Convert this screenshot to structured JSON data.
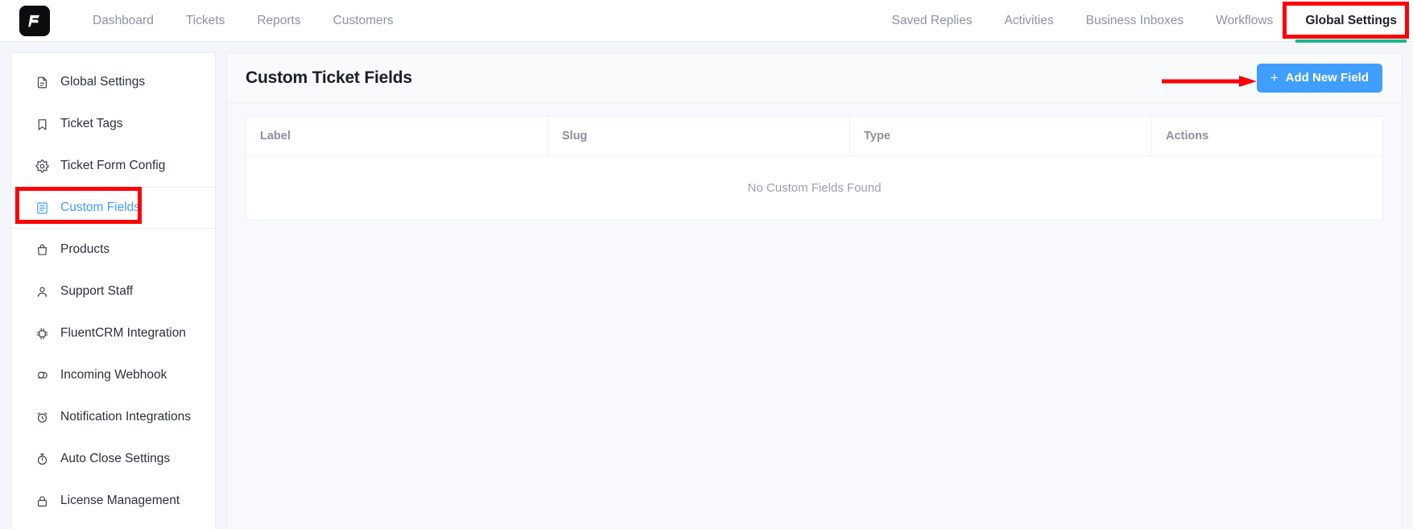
{
  "app": {
    "logo_icon": "fluent-support-logo-icon",
    "brand_color": "#0b0d0f"
  },
  "topnav": {
    "left_items": [
      {
        "label": "Dashboard",
        "name": "nav-dashboard"
      },
      {
        "label": "Tickets",
        "name": "nav-tickets"
      },
      {
        "label": "Reports",
        "name": "nav-reports"
      },
      {
        "label": "Customers",
        "name": "nav-customers"
      }
    ],
    "right_items": [
      {
        "label": "Saved Replies",
        "name": "nav-saved-replies",
        "active": false
      },
      {
        "label": "Activities",
        "name": "nav-activities",
        "active": false
      },
      {
        "label": "Business Inboxes",
        "name": "nav-business-inboxes",
        "active": false
      },
      {
        "label": "Workflows",
        "name": "nav-workflows",
        "active": false
      },
      {
        "label": "Global Settings",
        "name": "nav-global-settings",
        "active": true
      }
    ],
    "active_underline_color": "#10bc8c"
  },
  "sidebar": {
    "items": [
      {
        "label": "Global Settings",
        "icon": "document-icon",
        "active": false
      },
      {
        "label": "Ticket Tags",
        "icon": "bookmark-icon",
        "active": false
      },
      {
        "label": "Ticket Form Config",
        "icon": "gear-icon",
        "active": false
      },
      {
        "label": "Custom Fields",
        "icon": "list-document-icon",
        "active": true
      },
      {
        "label": "Products",
        "icon": "bag-icon",
        "active": false
      },
      {
        "label": "Support Staff",
        "icon": "user-icon",
        "active": false
      },
      {
        "label": "FluentCRM Integration",
        "icon": "chip-icon",
        "active": false
      },
      {
        "label": "Incoming Webhook",
        "icon": "webhook-icon",
        "active": false
      },
      {
        "label": "Notification Integrations",
        "icon": "alarm-icon",
        "active": false
      },
      {
        "label": "Auto Close Settings",
        "icon": "timer-icon",
        "active": false
      },
      {
        "label": "License Management",
        "icon": "lock-icon",
        "active": false
      }
    ],
    "active_color": "#409eff"
  },
  "main": {
    "title": "Custom Ticket Fields",
    "add_button": {
      "label": "Add New Field",
      "plus": "+",
      "color": "#409eff"
    },
    "table": {
      "headers": [
        "Label",
        "Slug",
        "Type",
        "Actions"
      ],
      "rows": [],
      "empty_message": "No Custom Fields Found"
    }
  },
  "annotations": {
    "color": "#fb0007",
    "boxes": [
      {
        "target": "Global Settings",
        "name": "annotation-box-global-settings"
      },
      {
        "target": "Custom Fields",
        "name": "annotation-box-custom-fields"
      }
    ],
    "arrow": {
      "target": "Add New Field",
      "name": "annotation-arrow-add-new-field"
    }
  }
}
